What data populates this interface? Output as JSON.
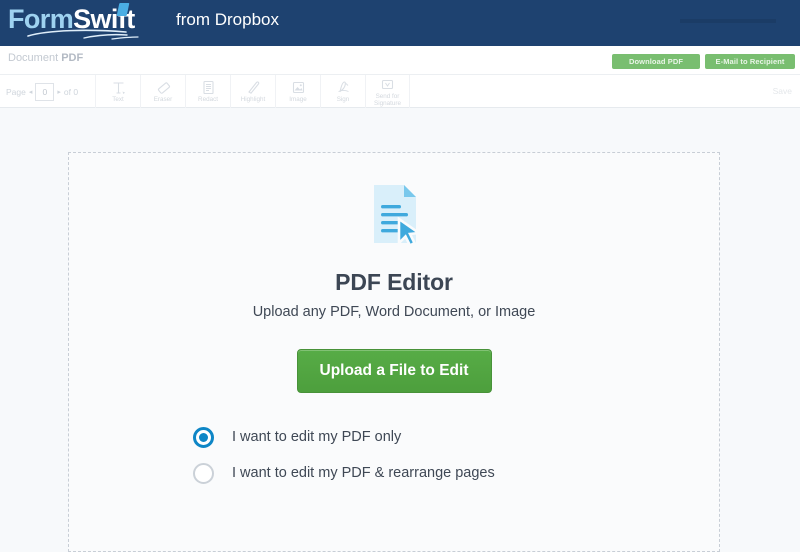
{
  "header": {
    "brand_form": "Form",
    "brand_swift": "Swift",
    "tagline": "from Dropbox",
    "accent_color": "#4aaee4",
    "background_color": "#1e4270"
  },
  "doc_bar": {
    "document_label": "Document",
    "document_type": "PDF",
    "download_pdf_label": "Download PDF",
    "email_recipient_label": "E-Mail to Recipient",
    "button_color": "#79be70"
  },
  "toolbar": {
    "page_label": "Page",
    "prev_icon": "triangle-left-icon",
    "next_icon": "triangle-right-icon",
    "page_value": "0",
    "page_of_label": "of 0",
    "save_label": "Save",
    "tools": [
      {
        "label": "Text",
        "icon": "text-tool-icon"
      },
      {
        "label": "Eraser",
        "icon": "eraser-tool-icon"
      },
      {
        "label": "Redact",
        "icon": "redact-tool-icon"
      },
      {
        "label": "Highlight",
        "icon": "highlight-tool-icon"
      },
      {
        "label": "Image",
        "icon": "image-tool-icon"
      },
      {
        "label": "Sign",
        "icon": "sign-tool-icon"
      },
      {
        "label": "Send for\nSignature",
        "icon": "send-signature-tool-icon"
      }
    ]
  },
  "dropzone": {
    "illustration": "document-with-cursor-icon",
    "title": "PDF Editor",
    "subtitle": "Upload any PDF, Word Document, or Image",
    "upload_button_label": "Upload a File to Edit",
    "upload_button_color": "#4d9f3d",
    "radio_selected_color": "#0e86c6",
    "options": [
      {
        "label": "I want to edit my PDF only",
        "selected": true
      },
      {
        "label": "I want to edit my PDF & rearrange pages",
        "selected": false
      }
    ]
  }
}
